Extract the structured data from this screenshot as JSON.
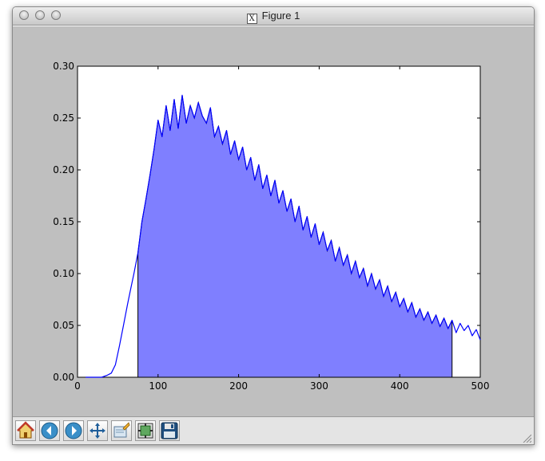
{
  "window": {
    "title": "Figure 1",
    "title_icon": "X"
  },
  "toolbar": {
    "buttons": [
      {
        "name": "home-button",
        "icon": "home-icon"
      },
      {
        "name": "back-button",
        "icon": "arrow-left-icon"
      },
      {
        "name": "forward-button",
        "icon": "arrow-right-icon"
      },
      {
        "name": "pan-button",
        "icon": "pan-arrows-icon"
      },
      {
        "name": "zoom-button",
        "icon": "zoom-rect-icon"
      },
      {
        "name": "subplots-button",
        "icon": "subplots-icon"
      },
      {
        "name": "save-button",
        "icon": "floppy-disk-icon"
      }
    ]
  },
  "chart_data": {
    "type": "area",
    "title": "",
    "xlabel": "",
    "ylabel": "",
    "xlim": [
      0,
      500
    ],
    "ylim": [
      0,
      0.3
    ],
    "xticks": [
      "0",
      "100",
      "200",
      "300",
      "400",
      "500"
    ],
    "yticks": [
      "0.00",
      "0.05",
      "0.10",
      "0.15",
      "0.20",
      "0.25",
      "0.30"
    ],
    "grid": false,
    "line_color": "#0000ff",
    "fill_color": "#7f7fff",
    "fill_range": [
      75,
      465
    ],
    "x": [
      10,
      30,
      37,
      42,
      47,
      52,
      57,
      62,
      66,
      70,
      75,
      80,
      85,
      90,
      95,
      100,
      105,
      110,
      115,
      120,
      125,
      130,
      135,
      140,
      145,
      150,
      155,
      160,
      165,
      170,
      175,
      180,
      185,
      190,
      195,
      200,
      205,
      210,
      215,
      220,
      225,
      230,
      235,
      240,
      245,
      250,
      255,
      260,
      265,
      270,
      275,
      280,
      285,
      290,
      295,
      300,
      305,
      310,
      315,
      320,
      325,
      330,
      335,
      340,
      345,
      350,
      355,
      360,
      365,
      370,
      375,
      380,
      385,
      390,
      395,
      400,
      405,
      410,
      415,
      420,
      425,
      430,
      435,
      440,
      445,
      450,
      455,
      460,
      465,
      470,
      475,
      480,
      485,
      490,
      495,
      500
    ],
    "y": [
      0.0,
      0.0,
      0.002,
      0.004,
      0.012,
      0.03,
      0.05,
      0.07,
      0.085,
      0.1,
      0.12,
      0.15,
      0.172,
      0.195,
      0.22,
      0.248,
      0.232,
      0.262,
      0.238,
      0.268,
      0.24,
      0.272,
      0.245,
      0.262,
      0.25,
      0.265,
      0.252,
      0.245,
      0.26,
      0.232,
      0.242,
      0.225,
      0.238,
      0.215,
      0.228,
      0.21,
      0.222,
      0.2,
      0.212,
      0.19,
      0.205,
      0.182,
      0.195,
      0.175,
      0.19,
      0.168,
      0.18,
      0.16,
      0.172,
      0.15,
      0.165,
      0.142,
      0.155,
      0.135,
      0.148,
      0.128,
      0.14,
      0.122,
      0.132,
      0.112,
      0.125,
      0.108,
      0.118,
      0.1,
      0.112,
      0.096,
      0.105,
      0.088,
      0.1,
      0.085,
      0.094,
      0.078,
      0.088,
      0.073,
      0.082,
      0.068,
      0.076,
      0.063,
      0.072,
      0.058,
      0.066,
      0.055,
      0.063,
      0.052,
      0.06,
      0.049,
      0.057,
      0.047,
      0.055,
      0.043,
      0.052,
      0.045,
      0.05,
      0.04,
      0.046,
      0.036
    ]
  }
}
